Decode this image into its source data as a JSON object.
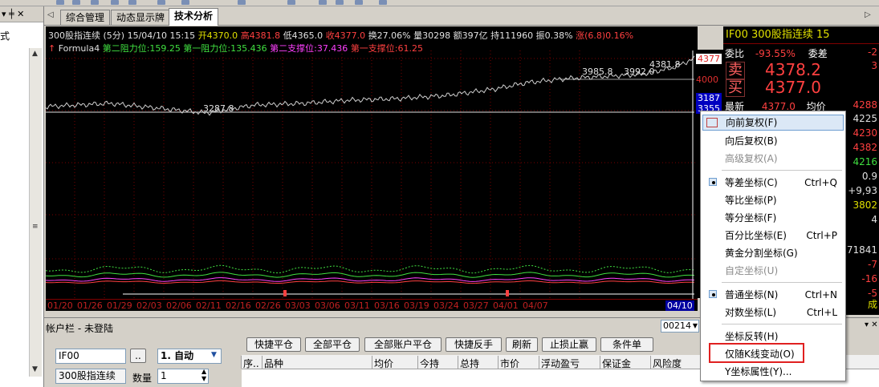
{
  "tabs": [
    "综合管理",
    "动态显示牌",
    "技术分析"
  ],
  "left_panel": {
    "pin": "▾ ╪ ✕",
    "text": "式"
  },
  "chart": {
    "info_line": {
      "name": "300股指连续 (5分)",
      "datetime": "15/04/10 15:15",
      "open": "开4370.0",
      "high": "高4381.8",
      "low": "低4365.0",
      "close": "收4377.0",
      "turnover": "换27.06%",
      "volume": "量30298",
      "amount": "额397亿",
      "oi": "持111960",
      "amplitude": "振0.38%",
      "change": "涨(6.8)0.16%"
    },
    "formula_line": {
      "name": "Formula4",
      "r2": "第二阻力位:159.25",
      "r1": "第一阻力位:135.436",
      "s2": "第二支撑位:37.436",
      "s1": "第一支撑位:61.25"
    },
    "annotations": [
      "3287.8",
      "3985.8",
      "3992.0",
      "4381.8"
    ],
    "price_labels": [
      "4377",
      "4000",
      "3187",
      "3355"
    ],
    "dates": [
      "01/20",
      "01/26",
      "01/29",
      "02/03",
      "02/06",
      "02/11",
      "02/16",
      "02/26",
      "03/03",
      "03/06",
      "03/11",
      "03/16",
      "03/19",
      "03/24",
      "03/27",
      "04/01",
      "04/07",
      "04/10"
    ]
  },
  "quote": {
    "code": "IF00",
    "name": "300股指连续",
    "period": "15",
    "weibi_label": "委比",
    "weibi_value": "-93.55%",
    "weicha_label": "委差",
    "weicha_value": "-2",
    "sell_label": "卖",
    "sell_price": "4378.2",
    "sell_vol": "3",
    "buy_label": "买",
    "buy_price": "4377.0",
    "latest_label": "最新",
    "latest_value": "4377.0",
    "avg_label": "均价",
    "avg_value": "4288",
    "right_values": [
      "4225",
      "4230",
      "4382",
      "4216",
      "0.9",
      "+9,93",
      "3802",
      "4",
      "71841",
      "-7",
      "-16",
      "-5"
    ],
    "footer_label": "成"
  },
  "account": {
    "title": "帐户栏 - 未登陆",
    "selector": "00214",
    "code_value": "IF00",
    "dots_button": "..",
    "mode_value": "1. 自动",
    "name_value": "300股指连续",
    "qty_label": "数量",
    "qty_value": "1",
    "buttons": [
      "快捷平仓",
      "全部平仓",
      "全部账户平仓",
      "快捷反手",
      "刷新",
      "止损止赢",
      "条件单"
    ],
    "columns": [
      "序..",
      "品种",
      "均价",
      "今持",
      "总持",
      "市价",
      "浮动盈亏",
      "保证金",
      "风险度"
    ]
  },
  "menu": {
    "items": [
      {
        "label": "向前复权(F)",
        "shortcut": "",
        "state": "hover"
      },
      {
        "label": "向后复权(B)",
        "shortcut": "",
        "state": "normal"
      },
      {
        "label": "高级复权(A)",
        "shortcut": "",
        "state": "disabled"
      },
      {
        "label": "等差坐标(C)",
        "shortcut": "Ctrl+Q",
        "state": "checked"
      },
      {
        "label": "等比坐标(P)",
        "shortcut": "",
        "state": "normal"
      },
      {
        "label": "等分坐标(F)",
        "shortcut": "",
        "state": "normal"
      },
      {
        "label": "百分比坐标(E)",
        "shortcut": "Ctrl+P",
        "state": "normal"
      },
      {
        "label": "黄金分割坐标(G)",
        "shortcut": "",
        "state": "normal"
      },
      {
        "label": "自定坐标(U)",
        "shortcut": "",
        "state": "disabled"
      },
      {
        "label": "普通坐标(N)",
        "shortcut": "Ctrl+N",
        "state": "checked"
      },
      {
        "label": "对数坐标(L)",
        "shortcut": "Ctrl+L",
        "state": "normal"
      },
      {
        "label": "坐标反转(H)",
        "shortcut": "",
        "state": "normal"
      },
      {
        "label": "仅随K线变动(O)",
        "shortcut": "",
        "state": "highlighted"
      },
      {
        "label": "Y坐标属性(Y)...",
        "shortcut": "",
        "state": "normal"
      }
    ]
  },
  "colors": {
    "chart_bg": "#000000",
    "up": "#ff4040",
    "down": "#40e040",
    "accent": "#e02020"
  }
}
